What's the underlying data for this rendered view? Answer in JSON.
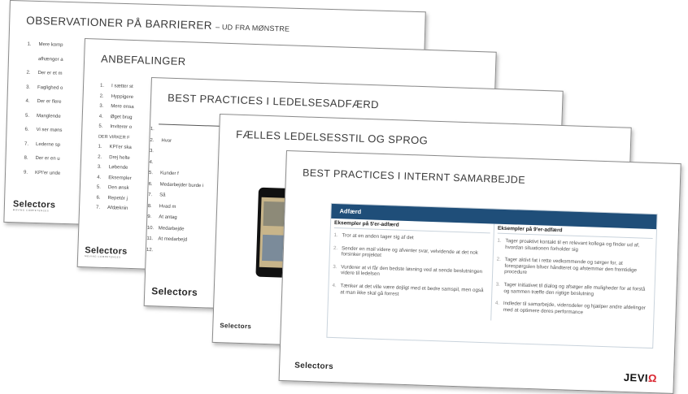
{
  "slides": {
    "observationer": {
      "title": "OBSERVATIONER PÅ BARRIERER",
      "subtitle": "– UD FRA MØNSTRE",
      "items": [
        "1.|Mere komp",
        "|afhænger a",
        "2.|Der er et m",
        "3.|Faglighed o",
        "4.|Der er flere",
        "5.|Manglende",
        "6.|Vi ser møns",
        "7.|Lederne sp",
        "8.|Der er en u",
        "9.|KPI'er unde"
      ],
      "logo": "Selectors",
      "logo_sub": "MOVING COMPETENCES"
    },
    "anbefalinger": {
      "title": "ANBEFALINGER",
      "items": [
        "1.|I sætter st",
        "2.|Hyppigere",
        "3.|Mere ensa",
        "4.|Øget brug",
        "5.|Inviterer o"
      ],
      "sublabel": "DER VIRKER F",
      "items2": [
        "1.|KPI'er ska",
        "2.|Drej helte",
        "3.|Løbende",
        "4.|Eksempler",
        "5.|Den ønsk",
        "6.|Repetér j",
        "7.|Afdæknin"
      ],
      "logo": "Selectors",
      "logo_sub": "MOVING COMPETENCES"
    },
    "best_practices_ledelse": {
      "title": "BEST PRACTICES I LEDELSESADFÆRD",
      "items": [
        "1.|",
        "2.|Hvor",
        "3.|",
        "4.|",
        "5.|Kunder f",
        "6.|Medarbejder burde i",
        "7.|Så",
        "8.|Hvad m",
        "9.|At antag",
        "10.|Medarbejde",
        "11.|At medarbejd",
        "12.|"
      ],
      "logo": "Selectors"
    },
    "faelles": {
      "title": "FÆLLES LEDELSESSTIL OG SPROG",
      "logo": "Selectors"
    },
    "internt": {
      "title": "BEST PRACTICES I INTERNT SAMARBEJDE",
      "panel_title": "Adfærd",
      "col1_title": "Eksempler på 5'er-adfærd",
      "col2_title": "Eksempler på 9'er-adfærd",
      "col1": [
        {
          "n": "1.",
          "t": "Tror at en anden tager sig af det"
        },
        {
          "n": "2.",
          "t": "Sender en mail videre og afventer svar, velvidende at det nok forsinker projektet"
        },
        {
          "n": "3.",
          "t": "Vurderer at vi får den bedste løsning ved at sende beslutningen videre til ledelsen"
        },
        {
          "n": "4.",
          "t": "Tænker at det ville være dejligt med et bedre samspil, men også at man ikke skal gå forrest"
        }
      ],
      "col2": [
        {
          "n": "1.",
          "t": "Tager proaktivt kontakt til en relevant kollega og finder ud af, hvordan situationen forholder sig"
        },
        {
          "n": "2.",
          "t": "Tager aktivt fat i rette vedkommende og sørger for, at forespørgslen bliver håndteret og afstemmer den fremtidige procedure"
        },
        {
          "n": "3.",
          "t": "Tager initiativet til dialog og afsøger alle muligheder for at forstå og sammen træffe den rigtige beslutning"
        },
        {
          "n": "4.",
          "t": "Indleder til samarbejde, vidensdeler og hjælper andre afdelinger med at optimere deres performance"
        }
      ],
      "logo": "Selectors",
      "client_logo_a": "JEVI",
      "client_logo_b": "Ω"
    }
  }
}
